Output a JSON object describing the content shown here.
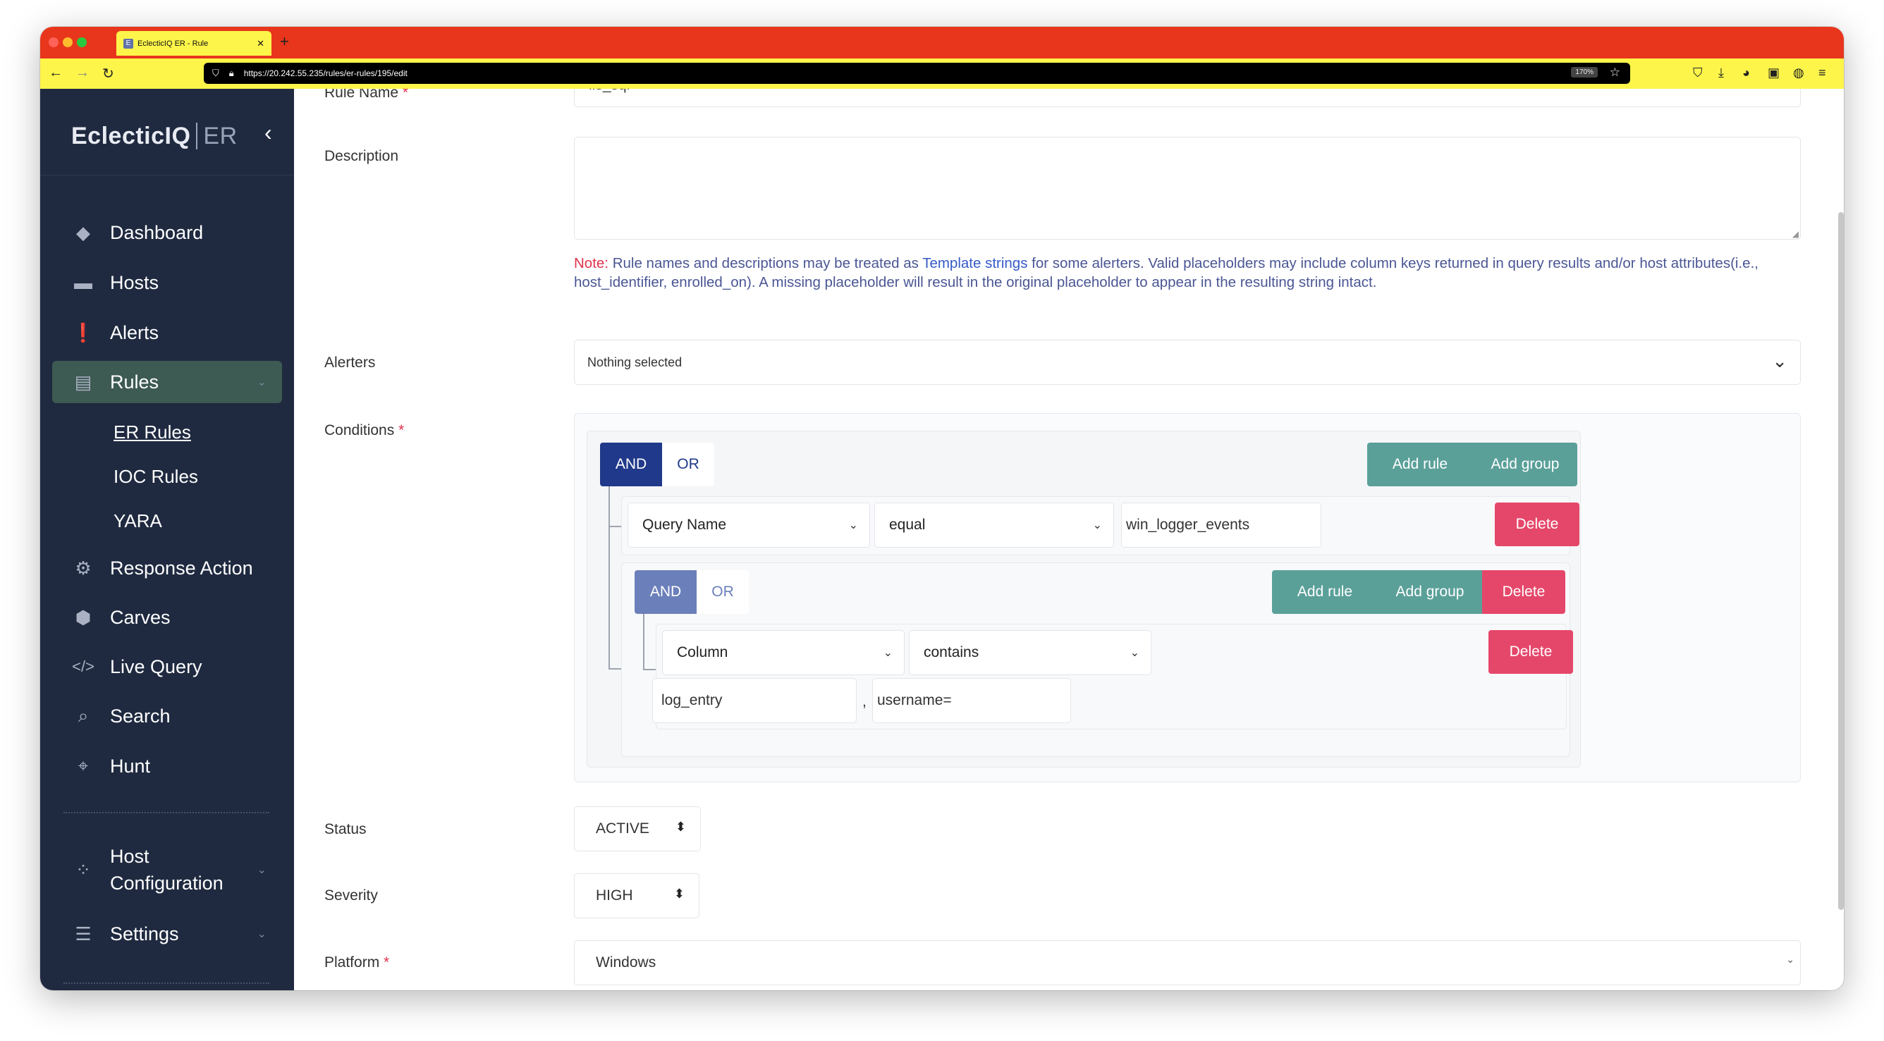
{
  "browser": {
    "tab_title": "EclecticIQ ER - Rule",
    "tab_favicon": "E",
    "url": "https://20.242.55.235/rules/er-rules/195/edit",
    "zoom": "170%",
    "colors": {
      "titlebar": "#e8361d",
      "toolbar": "#fdf54a"
    }
  },
  "sidebar": {
    "logo_main": "EclecticIQ",
    "logo_sub": "ER",
    "items": [
      {
        "label": "Dashboard",
        "icon": "layers-icon"
      },
      {
        "label": "Hosts",
        "icon": "monitor-icon"
      },
      {
        "label": "Alerts",
        "icon": "alert-icon"
      },
      {
        "label": "Rules",
        "icon": "clipboard-icon"
      },
      {
        "label": "Response Action",
        "icon": "gear-icon"
      },
      {
        "label": "Carves",
        "icon": "hexagon-icon"
      },
      {
        "label": "Live Query",
        "icon": "code-icon"
      },
      {
        "label": "Search",
        "icon": "search-icon"
      },
      {
        "label": "Hunt",
        "icon": "crosshair-icon"
      }
    ],
    "rules_subitems": [
      "ER Rules",
      "IOC Rules",
      "YARA"
    ],
    "bottom_items": [
      {
        "label_line1": "Host",
        "label_line2": "Configuration",
        "icon": "config-icon"
      },
      {
        "label": "Settings",
        "icon": "server-icon"
      }
    ]
  },
  "form": {
    "rule_name_label": "Rule Name",
    "rule_name_value": "iis_sql",
    "description_label": "Description",
    "description_value": "",
    "note_prefix": "Note:",
    "note_part1": " Rule names and descriptions may be treated as ",
    "note_link": "Template strings",
    "note_part2": " for some alerters. Valid placeholders may include column keys returned in query results and/or host attributes(i.e., host_identifier, enrolled_on). A missing placeholder will result in the original placeholder to appear in the resulting string intact.",
    "alerters_label": "Alerters",
    "alerters_value": "Nothing selected",
    "conditions_label": "Conditions",
    "status_label": "Status",
    "status_value": "ACTIVE",
    "severity_label": "Severity",
    "severity_value": "HIGH",
    "platform_label": "Platform",
    "platform_value": "Windows"
  },
  "query_builder": {
    "and_label": "AND",
    "or_label": "OR",
    "add_rule_label": "Add rule",
    "add_group_label": "Add group",
    "delete_label": "Delete",
    "rule1": {
      "field": "Query Name",
      "operator": "equal",
      "value": "win_logger_events"
    },
    "group2": {
      "rule": {
        "field": "Column",
        "operator": "contains",
        "value1": "log_entry",
        "separator": ",",
        "value2": "username="
      }
    }
  }
}
